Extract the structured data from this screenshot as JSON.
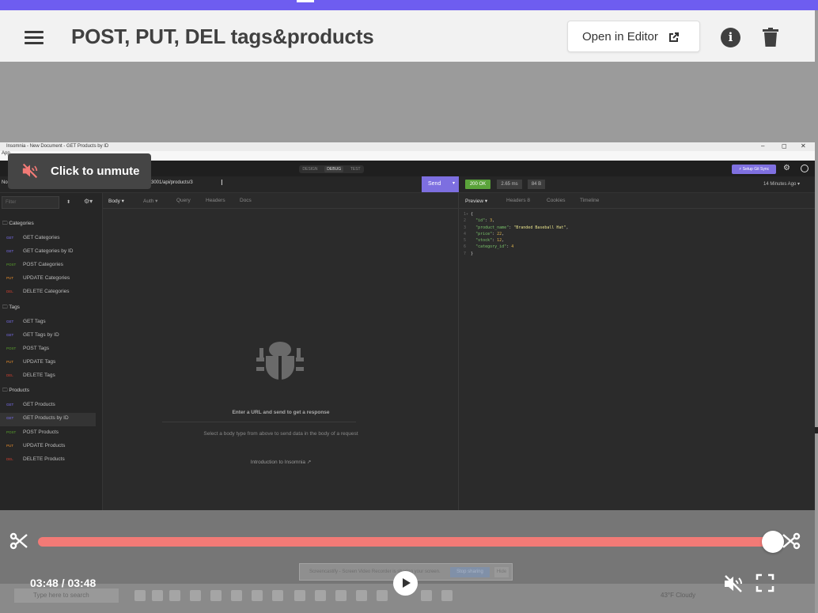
{
  "header": {
    "title": "POST, PUT,  DEL tags&products",
    "open_in_editor": "Open in Editor",
    "info_symbol": "i"
  },
  "recording": {
    "window_title": "Insomnia - New Document - GET Products by ID",
    "app_menu": "App",
    "window_controls": [
      "–",
      "◻",
      "✕"
    ],
    "mode_tabs": [
      "DESIGN",
      "DEBUG",
      "TEST"
    ],
    "active_mode": "DEBUG",
    "setup_sync": "⚡ Setup Git Sync",
    "url_prefix": "No",
    "url": "3001/api/products/3",
    "send": "Send",
    "status": "200 OK",
    "time": "2.65 ms",
    "size": "84 B",
    "ago": "14 Minutes Ago",
    "filter_placeholder": "Filter",
    "folders": [
      {
        "name": "Categories",
        "requests": [
          {
            "method": "GET",
            "name": "GET Categories"
          },
          {
            "method": "GET",
            "name": "GET Categories by ID"
          },
          {
            "method": "POST",
            "name": "POST Categories"
          },
          {
            "method": "PUT",
            "name": "UPDATE Categories"
          },
          {
            "method": "DEL",
            "name": "DELETE Categories"
          }
        ]
      },
      {
        "name": "Tags",
        "requests": [
          {
            "method": "GET",
            "name": "GET Tags"
          },
          {
            "method": "GET",
            "name": "GET Tags by ID"
          },
          {
            "method": "POST",
            "name": "POST Tags"
          },
          {
            "method": "PUT",
            "name": "UPDATE Tags"
          },
          {
            "method": "DEL",
            "name": "DELETE Tags"
          }
        ]
      },
      {
        "name": "Products",
        "requests": [
          {
            "method": "GET",
            "name": "GET Products"
          },
          {
            "method": "GET",
            "name": "GET Products by ID"
          },
          {
            "method": "POST",
            "name": "POST Products"
          },
          {
            "method": "PUT",
            "name": "UPDATE Products"
          },
          {
            "method": "DEL",
            "name": "DELETE Products"
          }
        ]
      }
    ],
    "selected_request": "GET Products by ID",
    "request_tabs": [
      "Body ▾",
      "Auth ▾",
      "Query",
      "Headers",
      "Docs"
    ],
    "empty_title": "Enter a URL and send to get a response",
    "empty_subtitle": "Select a body type from above to send data in the body of a request",
    "intro_link": "Introduction to Insomnia ↗",
    "response_tabs": [
      "Preview ▾",
      "Headers 8",
      "Cookies",
      "Timeline"
    ],
    "response_lines": [
      {
        "n": "1",
        "text": "{"
      },
      {
        "n": "2",
        "key": "\"id\"",
        "val": "3",
        "type": "num"
      },
      {
        "n": "3",
        "key": "\"product_name\"",
        "val": "\"Branded Baseball Hat\"",
        "type": "str"
      },
      {
        "n": "4",
        "key": "\"price\"",
        "val": "22",
        "type": "num"
      },
      {
        "n": "5",
        "key": "\"stock\"",
        "val": "12",
        "type": "num"
      },
      {
        "n": "6",
        "key": "\"category_id\"",
        "val": "4",
        "type": "num",
        "last": true
      },
      {
        "n": "7",
        "text": "}"
      }
    ],
    "taskbar_search": "Type here to search",
    "taskbar_weather": "43°F Cloudy",
    "ghost_notice": "Screencastify - Screen Video Recorder is sharing your screen.",
    "ghost_stop": "Stop sharing",
    "ghost_hide": "Hide"
  },
  "player": {
    "unmute": "Click to unmute",
    "time": "03:48 / 03:48",
    "progress": 1.0
  },
  "colors": {
    "accent_purple": "#6e5df0",
    "progress_red": "#f27a76",
    "status_green": "#5aa33a"
  }
}
